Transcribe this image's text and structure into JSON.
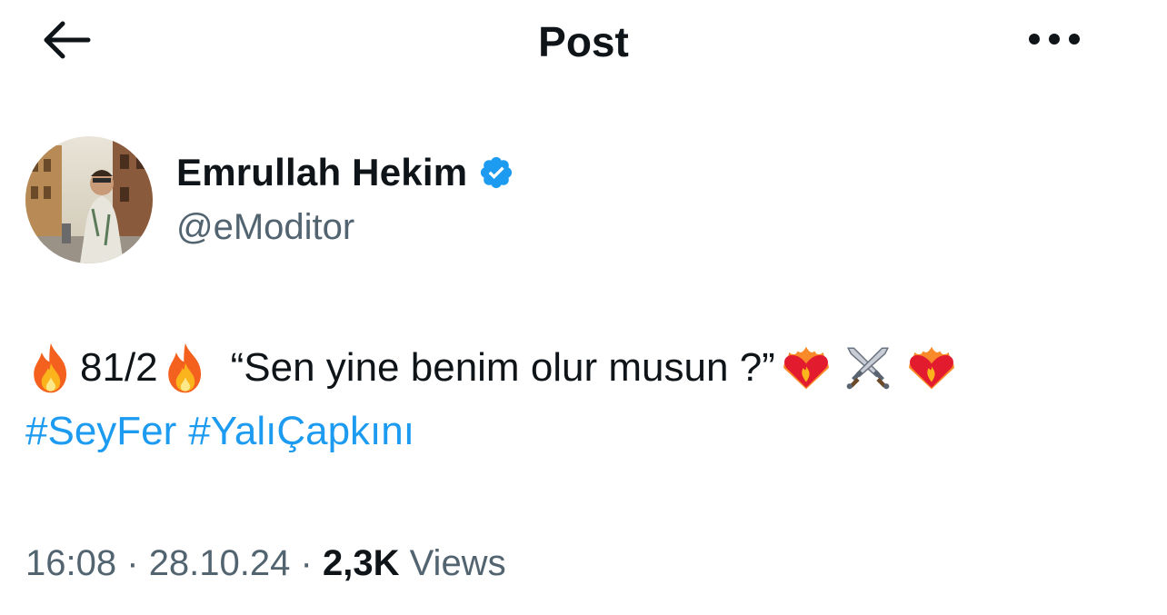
{
  "header": {
    "title": "Post",
    "back_icon": "arrow-left-icon",
    "more_icon": "more-horizontal-icon"
  },
  "author": {
    "display_name": "Emrullah Hekim",
    "handle": "@eModitor",
    "verified": true,
    "verified_color": "#1d9bf0"
  },
  "tweet": {
    "segment_1": "81/2",
    "quote": "“Sen yine benim olur musun ?”",
    "emojis": [
      "fire-emoji",
      "fire-emoji",
      "heart-on-fire-emoji",
      "crossed-swords-emoji",
      "heart-on-fire-emoji"
    ],
    "hashtags": [
      "#SeyFer",
      "#YalıÇapkını"
    ],
    "link_color": "#1d9bf0"
  },
  "meta": {
    "time": "16:08",
    "separator": "·",
    "date": "28.10.24",
    "views_count": "2,3K",
    "views_label": "Views"
  }
}
